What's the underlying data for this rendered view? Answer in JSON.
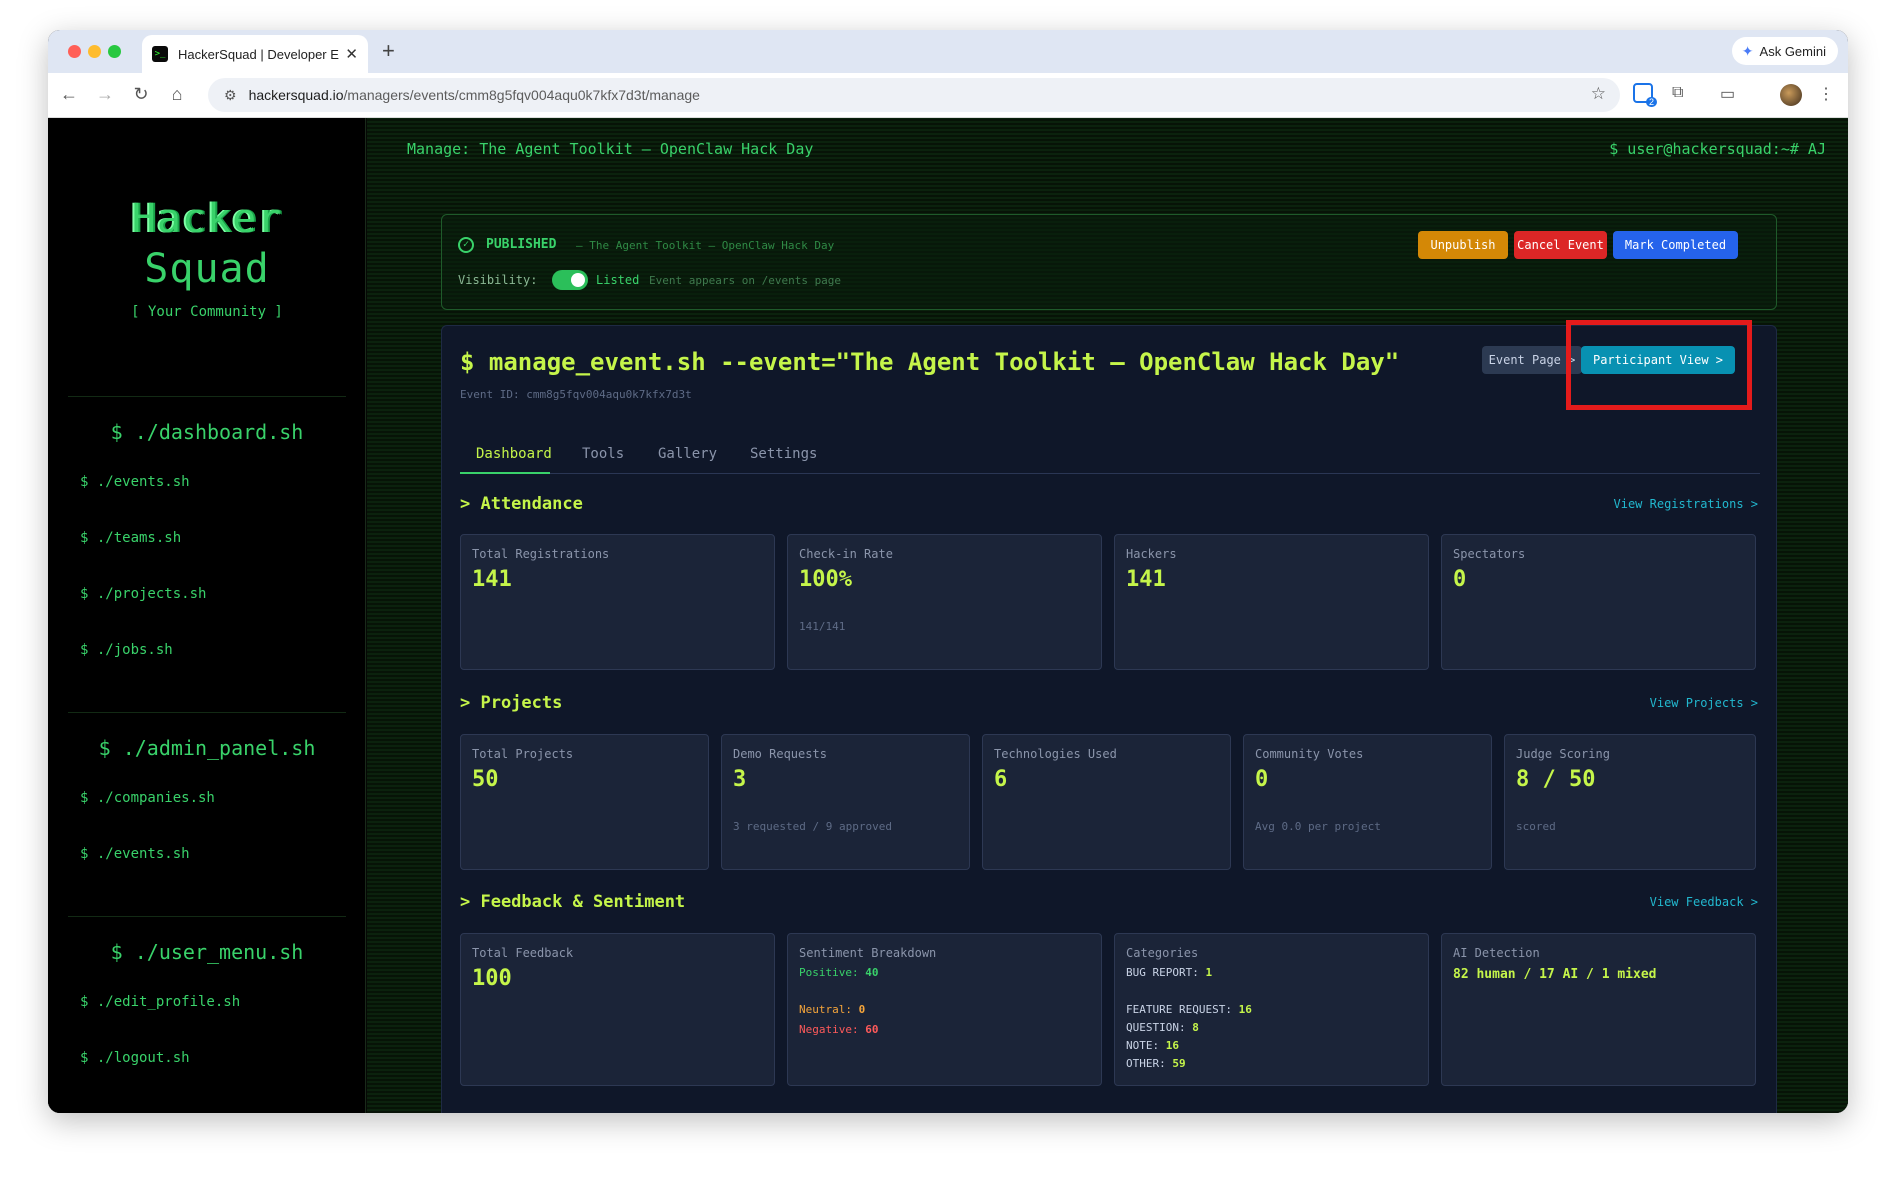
{
  "browser": {
    "tab_title": "HackerSquad | Developer Eco",
    "favicon_glyph": ">_",
    "close_glyph": "✕",
    "new_tab_glyph": "+",
    "gemini_label": "Ask Gemini",
    "url_domain": "hackersquad.io",
    "url_path": "/managers/events/cmm8g5fqv004aqu0k7kfx7d3t/manage",
    "ext_badge_count": "2"
  },
  "sidebar": {
    "logo_line1": "Hacker",
    "logo_line2": "Squad",
    "tagline": "[ Your Community ]",
    "sections": [
      {
        "heading": "$ ./dashboard.sh",
        "items": [
          "$ ./events.sh",
          "$ ./teams.sh",
          "$ ./projects.sh",
          "$ ./jobs.sh"
        ]
      },
      {
        "heading": "$ ./admin_panel.sh",
        "items": [
          "$ ./companies.sh",
          "$ ./events.sh"
        ]
      },
      {
        "heading": "$ ./user_menu.sh",
        "items": [
          "$ ./edit_profile.sh",
          "$ ./logout.sh"
        ]
      }
    ]
  },
  "topbar": {
    "title": "Manage: The Agent Toolkit — OpenClaw Hack Day",
    "user": "$ user@hackersquad:~# AJ"
  },
  "publish_bar": {
    "status": "PUBLISHED",
    "title": "— The Agent Toolkit — OpenClaw Hack Day",
    "visibility_label": "Visibility:",
    "visibility_value": "Listed",
    "visibility_hint": "Event appears on /events page",
    "buttons": {
      "unpublish": "Unpublish",
      "cancel": "Cancel Event",
      "complete": "Mark Completed"
    }
  },
  "event": {
    "command": "$ manage_event.sh --event=\"The Agent Toolkit — OpenClaw Hack Day\"",
    "event_id": "Event ID: cmm8g5fqv004aqu0k7kfx7d3t",
    "event_page_btn": "Event Page >",
    "participant_view_btn": "Participant View >"
  },
  "tabs": [
    "Dashboard",
    "Tools",
    "Gallery",
    "Settings"
  ],
  "attendance": {
    "heading": "> Attendance",
    "link": "View Registrations >",
    "stats": [
      {
        "label": "Total Registrations",
        "value": "141",
        "sub": ""
      },
      {
        "label": "Check-in Rate",
        "value": "100%",
        "sub": "141/141"
      },
      {
        "label": "Hackers",
        "value": "141",
        "sub": ""
      },
      {
        "label": "Spectators",
        "value": "0",
        "sub": ""
      }
    ]
  },
  "projects": {
    "heading": "> Projects",
    "link": "View Projects >",
    "stats": [
      {
        "label": "Total Projects",
        "value": "50",
        "sub": ""
      },
      {
        "label": "Demo Requests",
        "value": "3",
        "sub": "3 requested / 9 approved"
      },
      {
        "label": "Technologies Used",
        "value": "6",
        "sub": ""
      },
      {
        "label": "Community Votes",
        "value": "0",
        "sub": "Avg 0.0 per project"
      },
      {
        "label": "Judge Scoring",
        "value": "8 / 50",
        "sub": "scored"
      }
    ]
  },
  "feedback": {
    "heading": "> Feedback & Sentiment",
    "link": "View Feedback >",
    "total": {
      "label": "Total Feedback",
      "value": "100"
    },
    "sentiment": {
      "label": "Sentiment Breakdown",
      "positive_label": "Positive:",
      "positive": "40",
      "neutral_label": "Neutral:",
      "neutral": "0",
      "negative_label": "Negative:",
      "negative": "60"
    },
    "categories": {
      "label": "Categories",
      "items": [
        {
          "name": "BUG REPORT:",
          "count": "1"
        },
        {
          "name": "FEATURE REQUEST:",
          "count": "16"
        },
        {
          "name": "QUESTION:",
          "count": "8"
        },
        {
          "name": "NOTE:",
          "count": "16"
        },
        {
          "name": "OTHER:",
          "count": "59"
        }
      ]
    },
    "ai_detection": {
      "label": "AI Detection",
      "value": "82 human / 17 AI / 1 mixed"
    }
  },
  "colors": {
    "accent_green": "#39d26a",
    "lime": "#c5f54a",
    "unpublish": "#d48806",
    "cancel": "#dc2626",
    "complete": "#2563eb",
    "participant_view": "#0891b2",
    "highlight_box": "#e41b1b"
  }
}
